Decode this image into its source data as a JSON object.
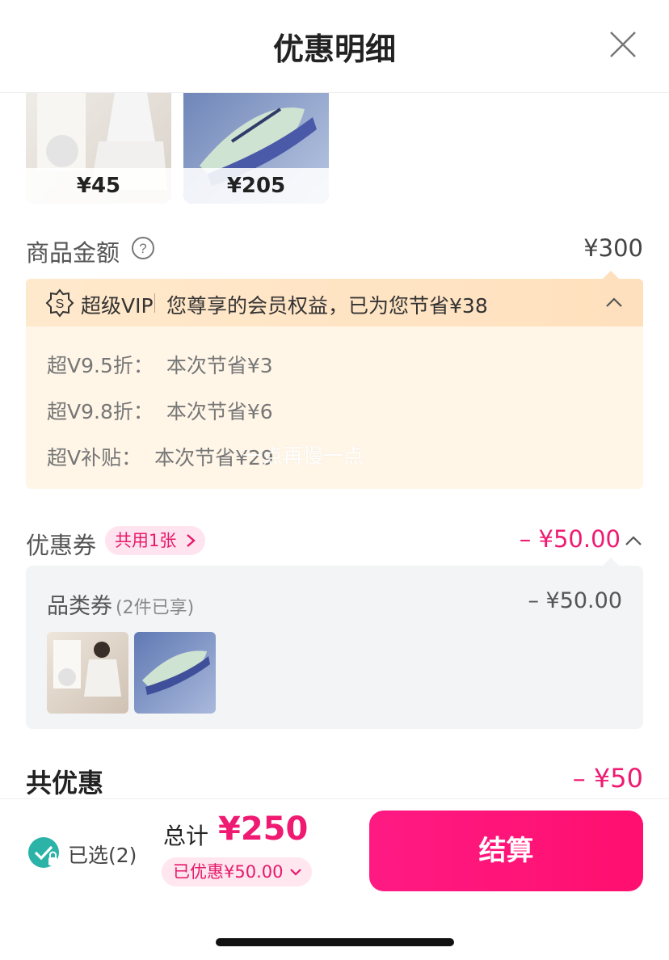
{
  "header": {
    "title": "优惠明细"
  },
  "products": [
    {
      "price": "¥45"
    },
    {
      "price": "¥205"
    }
  ],
  "amount": {
    "label": "商品金额",
    "value": "¥300"
  },
  "vip": {
    "brand": "超级VIP",
    "message": "您尊享的会员权益，已为您节省¥38",
    "lines": [
      {
        "label": "超V9.5折：",
        "save": "本次节省¥3"
      },
      {
        "label": "超V9.8折：",
        "save": "本次节省¥6"
      },
      {
        "label": "超V补贴：",
        "save": "本次节省¥29"
      }
    ],
    "watermark": "一点再慢一点"
  },
  "coupon": {
    "label": "优惠券",
    "tag": "共用1张",
    "value": "– ¥50.00",
    "category_label": "品类券",
    "category_sub": "(2件已享)",
    "category_value": "– ¥50.00"
  },
  "total_save": {
    "label": "共优惠",
    "value": "– ¥50"
  },
  "bottom": {
    "selected": "已选(2)",
    "total_label": "总计",
    "total_value": "¥250",
    "discount": "已优惠¥50.00",
    "checkout": "结算"
  },
  "colors": {
    "accent": "#ef1a72",
    "vip_bg": "#fff6e8",
    "checkout": "#ff1a83"
  }
}
